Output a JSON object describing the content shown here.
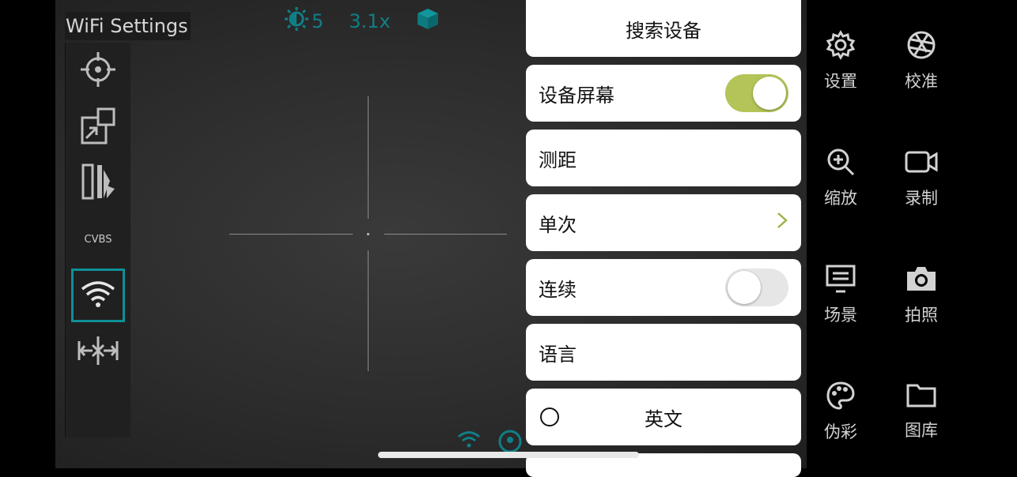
{
  "viewport": {
    "title": "WiFi Settings",
    "status": {
      "brightness_value": "5",
      "zoom": "3.1x"
    }
  },
  "left_bar": {
    "cvbs_label": "CVBS"
  },
  "menu": {
    "search_devices": "搜索设备",
    "device_screen": "设备屏幕",
    "device_screen_on": true,
    "ranging": "测距",
    "single": "单次",
    "continuous": "连续",
    "continuous_on": false,
    "language": "语言",
    "english": "英文"
  },
  "right_panel": {
    "settings": "设置",
    "calibrate": "校准",
    "zoom": "缩放",
    "record": "录制",
    "scene": "场景",
    "photo": "拍照",
    "pseudo_color": "伪彩",
    "gallery": "图库"
  },
  "colors": {
    "accent_teal": "#0e8f96",
    "toggle_on": "#b4c458",
    "chevron": "#9bb64a"
  }
}
